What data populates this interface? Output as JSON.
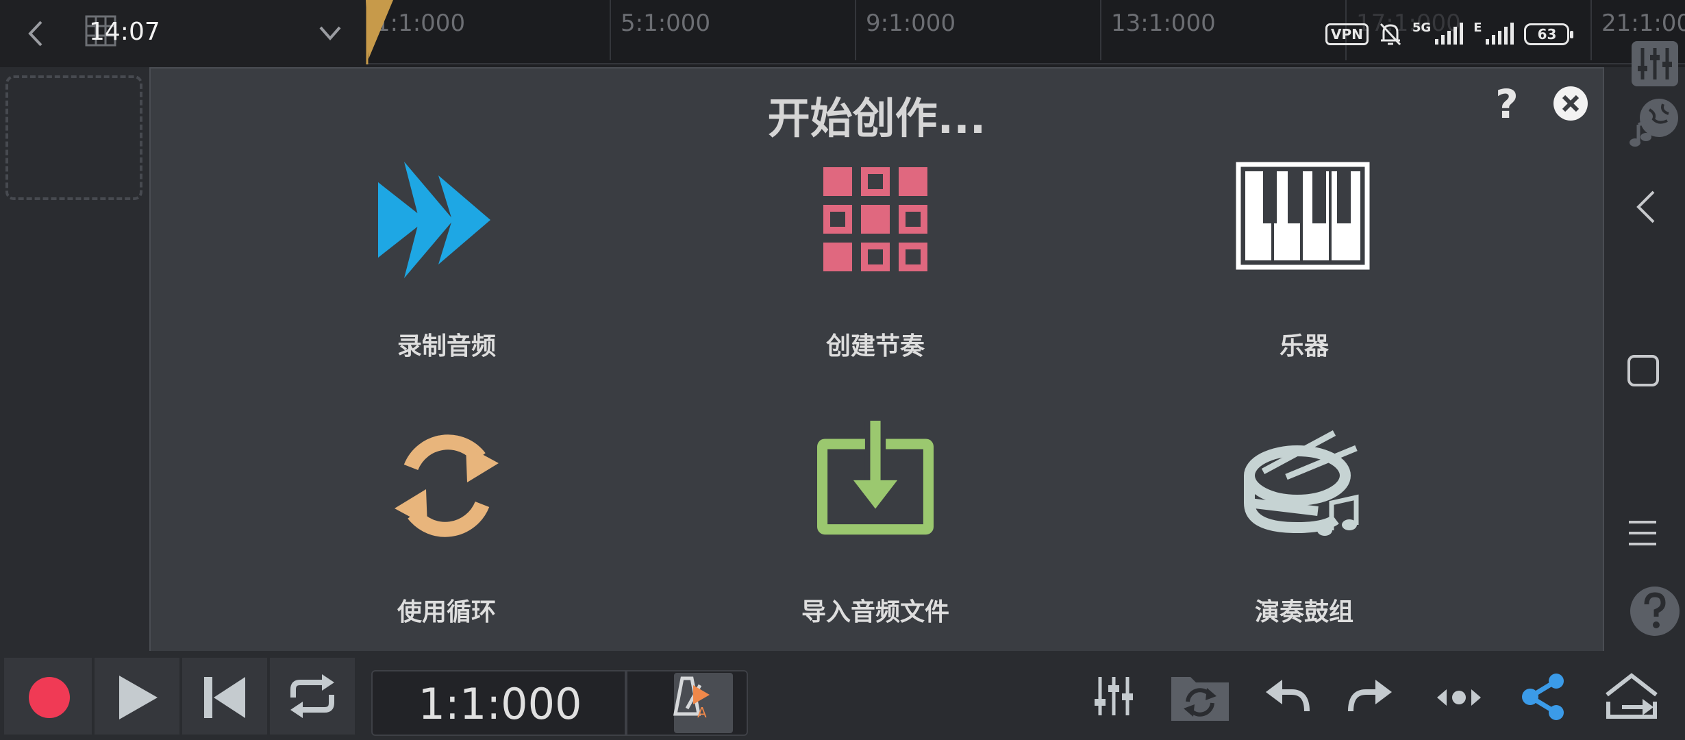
{
  "status_bar": {
    "time": "14:07",
    "vpn": "VPN",
    "network_5g": "5G",
    "network_e": "E",
    "battery": "63"
  },
  "timeline": {
    "marks": [
      "1:1:000",
      "5:1:000",
      "9:1:000",
      "13:1:000",
      "17:1:000",
      "21:1:00"
    ]
  },
  "modal": {
    "title": "开始创作...",
    "help": "?",
    "options": [
      {
        "label": "录制音频",
        "icon": "record-audio-icon",
        "color": "#1ea7e4"
      },
      {
        "label": "创建节奏",
        "icon": "beat-grid-icon",
        "color": "#e0687f"
      },
      {
        "label": "乐器",
        "icon": "piano-keys-icon",
        "color": "#ffffff"
      },
      {
        "label": "使用循环",
        "icon": "loop-icon",
        "color": "#e8b57c"
      },
      {
        "label": "导入音频文件",
        "icon": "import-audio-icon",
        "color": "#9bc86f"
      },
      {
        "label": "演奏鼓组",
        "icon": "drum-kit-icon",
        "color": "#c6d3d3"
      }
    ]
  },
  "transport": {
    "position": "1:1:000",
    "metronome_badge": "A"
  },
  "colors": {
    "record": "#f03a55",
    "share": "#3b9be8",
    "background": "#2a2c30",
    "modal": "#3a3d42"
  }
}
